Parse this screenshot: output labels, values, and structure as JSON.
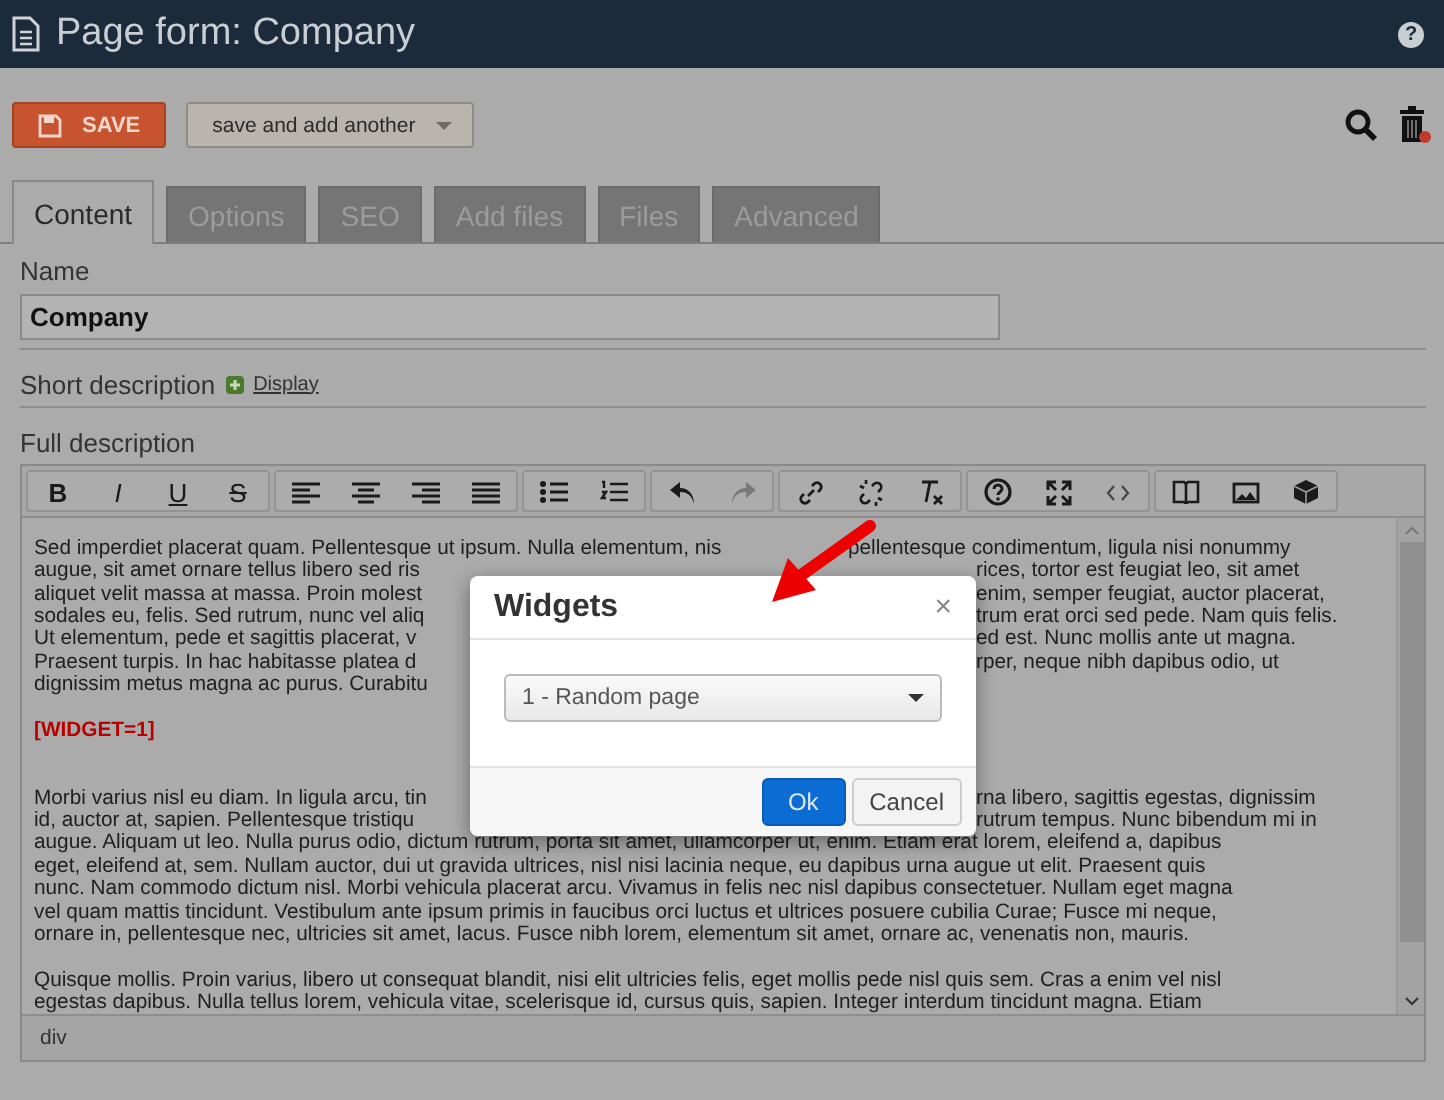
{
  "window": {
    "title": "Page form: Company",
    "help": "?"
  },
  "actions": {
    "save": "SAVE",
    "save_another": "save and add another"
  },
  "tabs": [
    {
      "label": "Content",
      "selected": true
    },
    {
      "label": "Options",
      "selected": false
    },
    {
      "label": "SEO",
      "selected": false
    },
    {
      "label": "Add files",
      "selected": false
    },
    {
      "label": "Files",
      "selected": false
    },
    {
      "label": "Advanced",
      "selected": false
    }
  ],
  "form": {
    "name_label": "Name",
    "name_value": "Company",
    "short_label": "Short description",
    "short_link": "Display",
    "full_label": "Full description"
  },
  "editor": {
    "format_buttons": [
      "B",
      "I",
      "U",
      "S"
    ],
    "lines": [
      {
        "kind": "arrowsplit",
        "left": "Sed imperdiet placerat quam. Pellentesque ut ipsum. Nulla elementum, nis",
        "right": "pellentesque condimentum, ligula nisi nonummy"
      },
      {
        "kind": "split",
        "left": "augue, sit amet ornare tellus libero sed ris",
        "right": "rices, tortor est feugiat leo, sit amet"
      },
      {
        "kind": "split",
        "left": "aliquet velit massa at massa. Proin molest",
        "right": "enim, semper feugiat, auctor placerat,"
      },
      {
        "kind": "split",
        "left": "sodales eu, felis. Sed rutrum, nunc vel aliq",
        "right": "trum erat orci sed pede. Nam quis felis."
      },
      {
        "kind": "split",
        "left": "Ut elementum, pede et sagittis placerat, v",
        "right": "ed est. Nunc mollis ante ut magna."
      },
      {
        "kind": "split",
        "left": "Praesent turpis. In hac habitasse platea d",
        "right": "rper, neque nibh dapibus odio, ut"
      },
      {
        "kind": "split",
        "left": "dignissim metus magna ac purus. Curabitu"
      },
      {
        "kind": "blank"
      },
      {
        "kind": "widget",
        "text": "[WIDGET=1]"
      },
      {
        "kind": "blank"
      },
      {
        "kind": "blank"
      },
      {
        "kind": "split",
        "left": "Morbi varius nisl eu diam. In ligula arcu, tin",
        "right": "rna libero, sagittis egestas, dignissim"
      },
      {
        "kind": "split",
        "left": "id, auctor at, sapien. Pellentesque tristiqu",
        "right": "rutrum tempus. Nunc bibendum mi in"
      },
      {
        "kind": "full",
        "text": "augue. Aliquam ut leo. Nulla purus odio, dictum rutrum, porta sit amet, ullamcorper ut, enim. Etiam erat lorem, eleifend a, dapibus"
      },
      {
        "kind": "full",
        "text": "eget, eleifend at, sem. Nullam auctor, dui ut gravida ultrices, nisl nisi lacinia neque, eu dapibus urna augue ut elit. Praesent quis"
      },
      {
        "kind": "full",
        "text": "nunc. Nam commodo dictum nisl. Morbi vehicula placerat arcu. Vivamus in felis nec nisl dapibus consectetuer. Nullam eget magna"
      },
      {
        "kind": "full",
        "text": "vel quam mattis tincidunt. Vestibulum ante ipsum primis in faucibus orci luctus et ultrices posuere cubilia Curae; Fusce mi neque,"
      },
      {
        "kind": "full",
        "text": "ornare in, pellentesque nec, ultricies sit amet, lacus. Fusce nibh lorem, elementum sit amet, ornare ac, venenatis non, mauris."
      },
      {
        "kind": "blank"
      },
      {
        "kind": "full",
        "text": "Quisque mollis. Proin varius, libero ut consequat blandit, nisi elit ultricies felis, eget mollis pede nisl quis sem. Cras a enim vel nisl"
      },
      {
        "kind": "full",
        "text": "egestas dapibus. Nulla tellus lorem, vehicula vitae, scelerisque id, cursus quis, sapien. Integer interdum tincidunt magna. Etiam"
      }
    ],
    "status": "div"
  },
  "dialog": {
    "title": "Widgets",
    "close": "×",
    "select_value": "1 - Random page",
    "buttons": [
      "Ok",
      "Cancel"
    ]
  }
}
